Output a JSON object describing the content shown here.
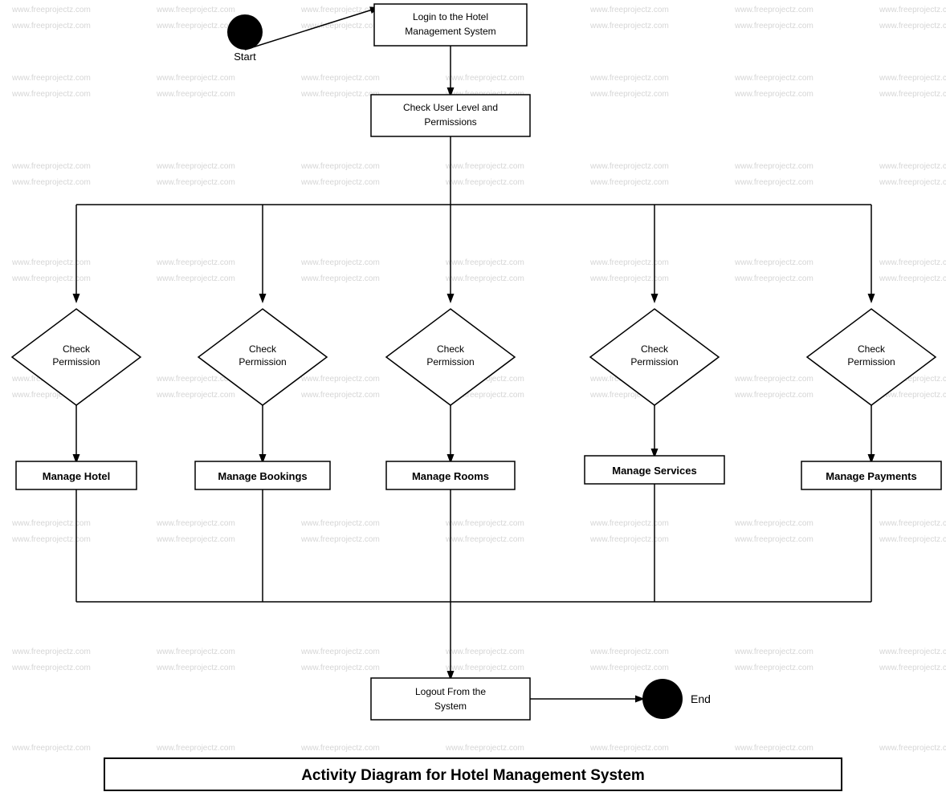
{
  "watermark": "www.freeprojectz.com",
  "title": "Activity Diagram for Hotel Management System",
  "nodes": {
    "start_label": "Start",
    "end_label": "End",
    "login": "Login to the Hotel\nManagement System",
    "check_user_level": "Check User Level and\nPermissions",
    "check_perm1": "Check\nPermission",
    "check_perm2": "Check\nPermission",
    "check_perm3": "Check\nPermission",
    "check_perm4": "Check\nPermission",
    "check_perm5": "Check\nPermission",
    "manage_hotel": "Manage Hotel",
    "manage_bookings": "Manage Bookings",
    "manage_rooms": "Manage Rooms",
    "manage_services": "Manage Services",
    "manage_payments": "Manage Payments",
    "logout": "Logout From the\nSystem"
  }
}
